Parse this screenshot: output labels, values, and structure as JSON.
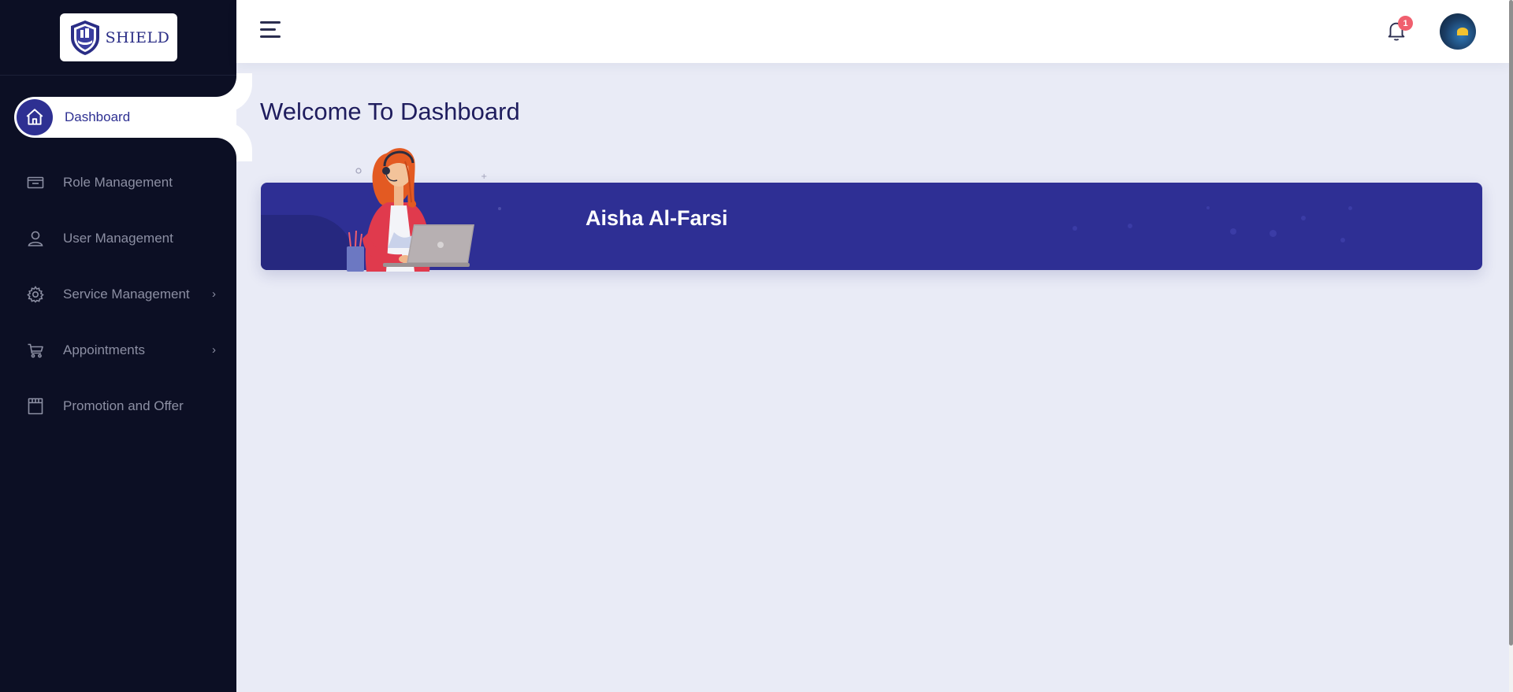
{
  "brand": {
    "name": "SHIELD",
    "logo_icon": "shield-logo-icon"
  },
  "sidebar": {
    "items": [
      {
        "label": "Dashboard",
        "icon": "home-icon",
        "active": true
      },
      {
        "label": "Role Management",
        "icon": "id-card-icon"
      },
      {
        "label": "User Management",
        "icon": "user-icon"
      },
      {
        "label": "Service Management",
        "icon": "gear-icon",
        "has_submenu": true
      },
      {
        "label": "Appointments",
        "icon": "cart-icon",
        "has_submenu": true
      },
      {
        "label": "Promotion and Offer",
        "icon": "calendar-icon"
      }
    ],
    "chevron": "›"
  },
  "topbar": {
    "menu_icon": "hamburger-icon",
    "notifications": {
      "icon": "bell-icon",
      "count": "1"
    },
    "avatar_icon": "user-avatar"
  },
  "main": {
    "title": "Welcome To Dashboard",
    "banner": {
      "user_name": "Aisha Al-Farsi",
      "illustration": "woman-with-headset-laptop"
    }
  },
  "colors": {
    "sidebar_bg": "#0c0f24",
    "accent": "#2e3092",
    "banner_bg": "#2e2f94",
    "page_bg": "#e9ebf6",
    "badge": "#f05f6e"
  }
}
